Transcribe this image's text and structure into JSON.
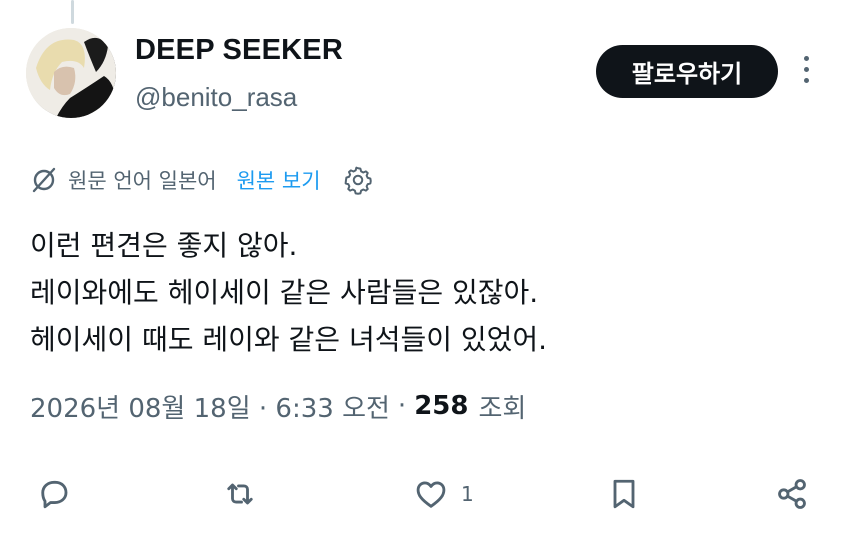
{
  "author": {
    "display_name": "DEEP SEEKER",
    "handle": "@benito_rasa"
  },
  "header": {
    "follow_label": "팔로우하기"
  },
  "translation": {
    "info": "원문 언어 일본어",
    "view_original": "원본 보기"
  },
  "tweet": {
    "lines": [
      "이런 편견은 좋지 않아.",
      "레이와에도 헤이세이 같은 사람들은 있잖아.",
      "헤이세이 때도 레이와 같은 녀석들이 있었어."
    ]
  },
  "meta": {
    "timestamp": "2026년 08월 18일 · 6:33 오전",
    "separator": "·",
    "views_count": "258",
    "views_label": "조회"
  },
  "actions": {
    "like_count": "1"
  },
  "icons": {
    "translate": "translate-slash-icon",
    "settings": "gear-icon",
    "reply": "reply-icon",
    "retweet": "retweet-icon",
    "like": "heart-icon",
    "bookmark": "bookmark-icon",
    "share": "share-icon",
    "more": "more-vertical-icon"
  },
  "colors": {
    "text": "#0f1419",
    "secondary": "#536471",
    "link": "#1d9bf0",
    "follow_bg": "#0f1419"
  }
}
